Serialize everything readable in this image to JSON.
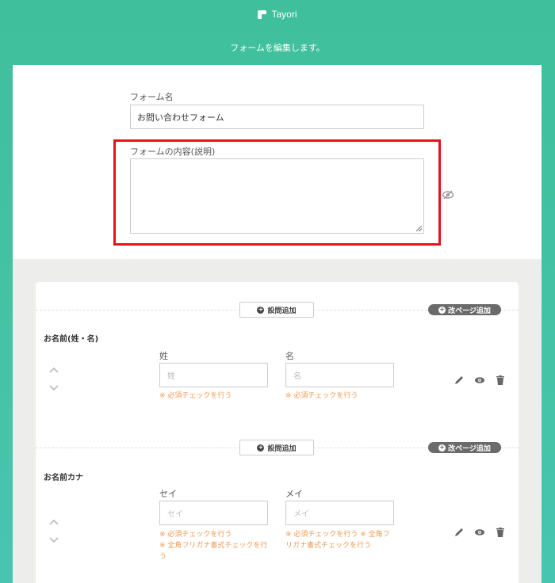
{
  "header": {
    "brand": "Tayori",
    "subtitle": "フォームを編集します。"
  },
  "form": {
    "name_label": "フォーム名",
    "name_value": "お問い合わせフォーム",
    "desc_label": "フォームの内容(説明)",
    "desc_value": ""
  },
  "buttons": {
    "add_question": "設問追加",
    "add_page": "改ページ追加"
  },
  "questions": [
    {
      "title": "お名前(姓・名)",
      "fields": [
        {
          "label": "姓",
          "placeholder": "姓",
          "note": "※ 必須チェックを行う"
        },
        {
          "label": "名",
          "placeholder": "名",
          "note": "※ 必須チェックを行う"
        }
      ]
    },
    {
      "title": "お名前カナ",
      "fields": [
        {
          "label": "セイ",
          "placeholder": "セイ",
          "note": "※ 必須チェックを行う\n※ 全角フリガナ書式チェックを行う"
        },
        {
          "label": "メイ",
          "placeholder": "メイ",
          "note": "※ 必須チェックを行う ※ 全角フリガナ書式チェックを行う"
        }
      ]
    }
  ],
  "colors": {
    "brand": "#3fbf9b",
    "highlight": "#e8121a",
    "note": "#f19a52"
  }
}
